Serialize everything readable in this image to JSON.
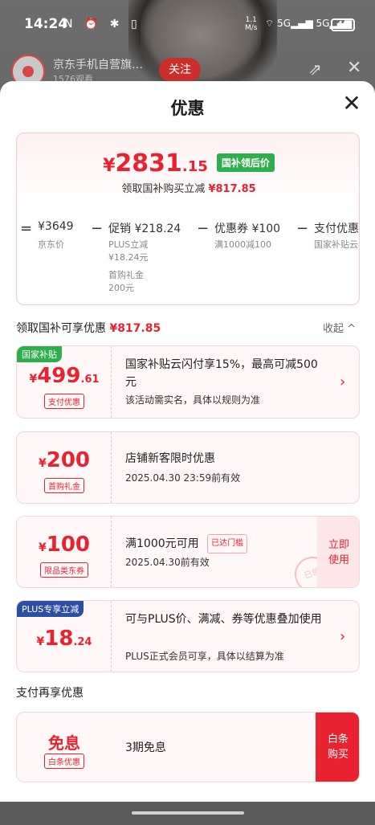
{
  "status_bar": {
    "time": "14:24",
    "sys_icons": "N ⏰ ✱ ▯",
    "net_speed": "1.1",
    "net_unit": "M/s",
    "signal": "⌔ 5G▂▄▆ 5G▂▄▆",
    "battery": "46"
  },
  "live": {
    "shop_name": "京东手机自营旗…",
    "viewers": "1576观看",
    "follow_label": "关注"
  },
  "sheet": {
    "title": "优惠",
    "main_price": {
      "yen": "¥",
      "int": "2831",
      "dec": ".15",
      "tag": "国补领后价"
    },
    "sub_label": "领取国补购买立减",
    "sub_amount": "¥817.85",
    "breakdown": [
      {
        "op": "=",
        "label": "¥3649",
        "sub": [
          "京东价"
        ]
      },
      {
        "op": "−",
        "label": "促销 ¥218.24",
        "sub": [
          "PLUS立减",
          "¥18.24元",
          "首购礼金",
          "200元"
        ]
      },
      {
        "op": "−",
        "label": "优惠券 ¥100",
        "sub": [
          "满1000减100"
        ]
      },
      {
        "op": "−",
        "label": "支付优惠",
        "sub": [
          "国家补贴云"
        ]
      }
    ],
    "section_title": "领取国补可享优惠",
    "section_amount": "¥817.85",
    "collapse_label": "收起 ^"
  },
  "cards": [
    {
      "corner_tag": "国家补贴",
      "corner_color": "#2eae4c",
      "yen": "¥",
      "int": "499",
      "dec": ".61",
      "chip": "支付优惠",
      "title": "国家补贴云闪付享15%，最高可减500元",
      "desc": "该活动需实名，具体以规则为准",
      "arrow": "›"
    },
    {
      "yen": "¥",
      "int": "200",
      "chip": "首购礼金",
      "title": "店铺新客限时优惠",
      "desc": "2025.04.30 23:59前有效"
    },
    {
      "yen": "¥",
      "int": "100",
      "chip": "限品类东券",
      "title": "满1000元可用",
      "badge": "已达门槛",
      "desc": "2025.04.30前有效",
      "action_1": "立即",
      "action_2": "使用",
      "stamp": "已领"
    },
    {
      "corner_tag": "PLUS专享立减",
      "corner_color": "#2d4fa3",
      "yen": "¥",
      "int": "18",
      "dec": ".24",
      "title": "可与PLUS价、满减、券等优惠叠加使用",
      "desc": "PLUS正式会员可享，具体以结算为准",
      "arrow": "›"
    }
  ],
  "pay_section": {
    "title": "支付再享优惠",
    "card_title": "免息",
    "card_chip": "白条优惠",
    "card_desc": "3期免息",
    "btn_1": "白条",
    "btn_2": "购买"
  }
}
